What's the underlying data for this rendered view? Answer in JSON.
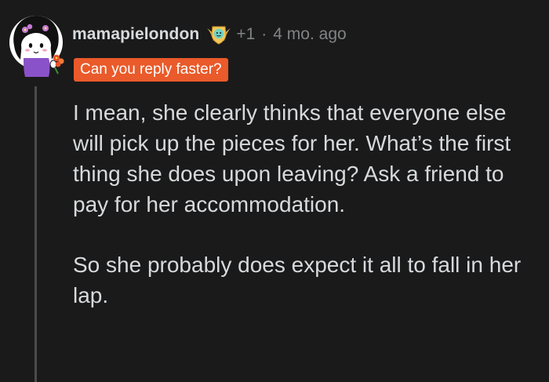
{
  "comment": {
    "username": "mamapielondon",
    "award_icon": "helpful-award-icon",
    "award_count": "+1",
    "separator": "·",
    "timestamp": "4 mo. ago",
    "flair": "Can you reply faster?",
    "flair_color": "#ea5a2a",
    "paragraphs": [
      "I mean, she clearly thinks that everyone else will pick up the pieces for her. What’s the first thing she does upon leaving? Ask a friend to pay for her accommodation.",
      "So she probably does expect it all to fall in her lap."
    ]
  },
  "colors": {
    "background": "#1a1a1b",
    "text": "#d7dadc",
    "meta": "#818384",
    "thread_line": "#4b4b4c"
  }
}
